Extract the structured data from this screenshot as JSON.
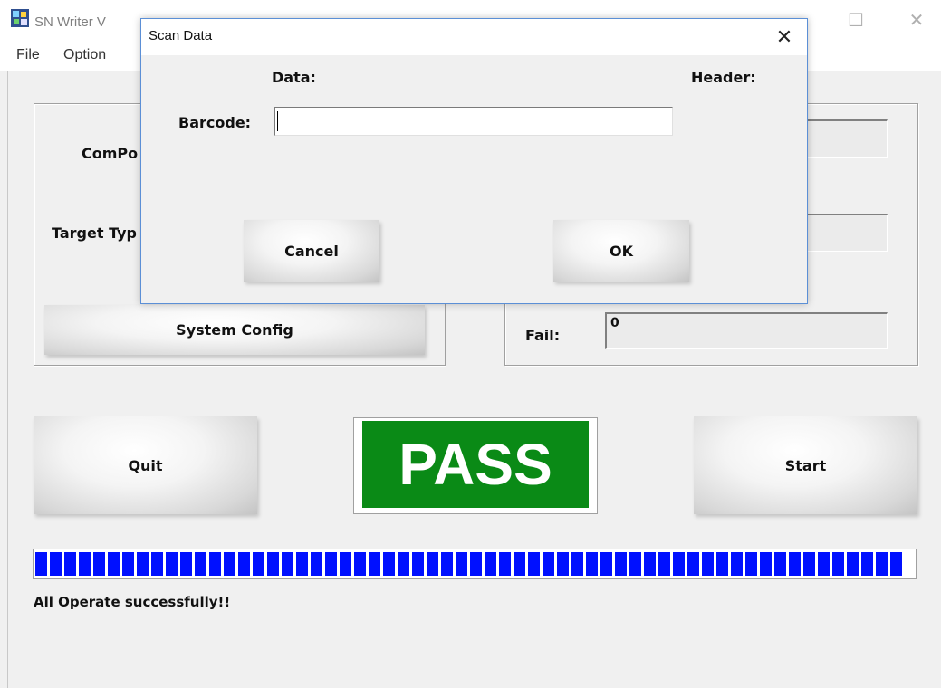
{
  "main": {
    "title": "SN Writer V",
    "menu": [
      "File",
      "Option"
    ],
    "left_group": {
      "comport_label": "ComPo",
      "target_type_label": "Target Typ",
      "system_config_button": "System Config"
    },
    "right_group": {
      "fail_label": "Fail:",
      "fail_value": "0"
    },
    "quit_button": "Quit",
    "start_button": "Start",
    "result_text": "PASS",
    "result_color": "#0a8a16",
    "progress_percent": 100,
    "progress_color": "#0010ff",
    "status_text": "All Operate successfully!!"
  },
  "dialog": {
    "title": "Scan Data",
    "close_icon": "close-icon",
    "data_label": "Data:",
    "header_label": "Header:",
    "barcode_label": "Barcode:",
    "barcode_value": "",
    "cancel_button": "Cancel",
    "ok_button": "OK"
  }
}
